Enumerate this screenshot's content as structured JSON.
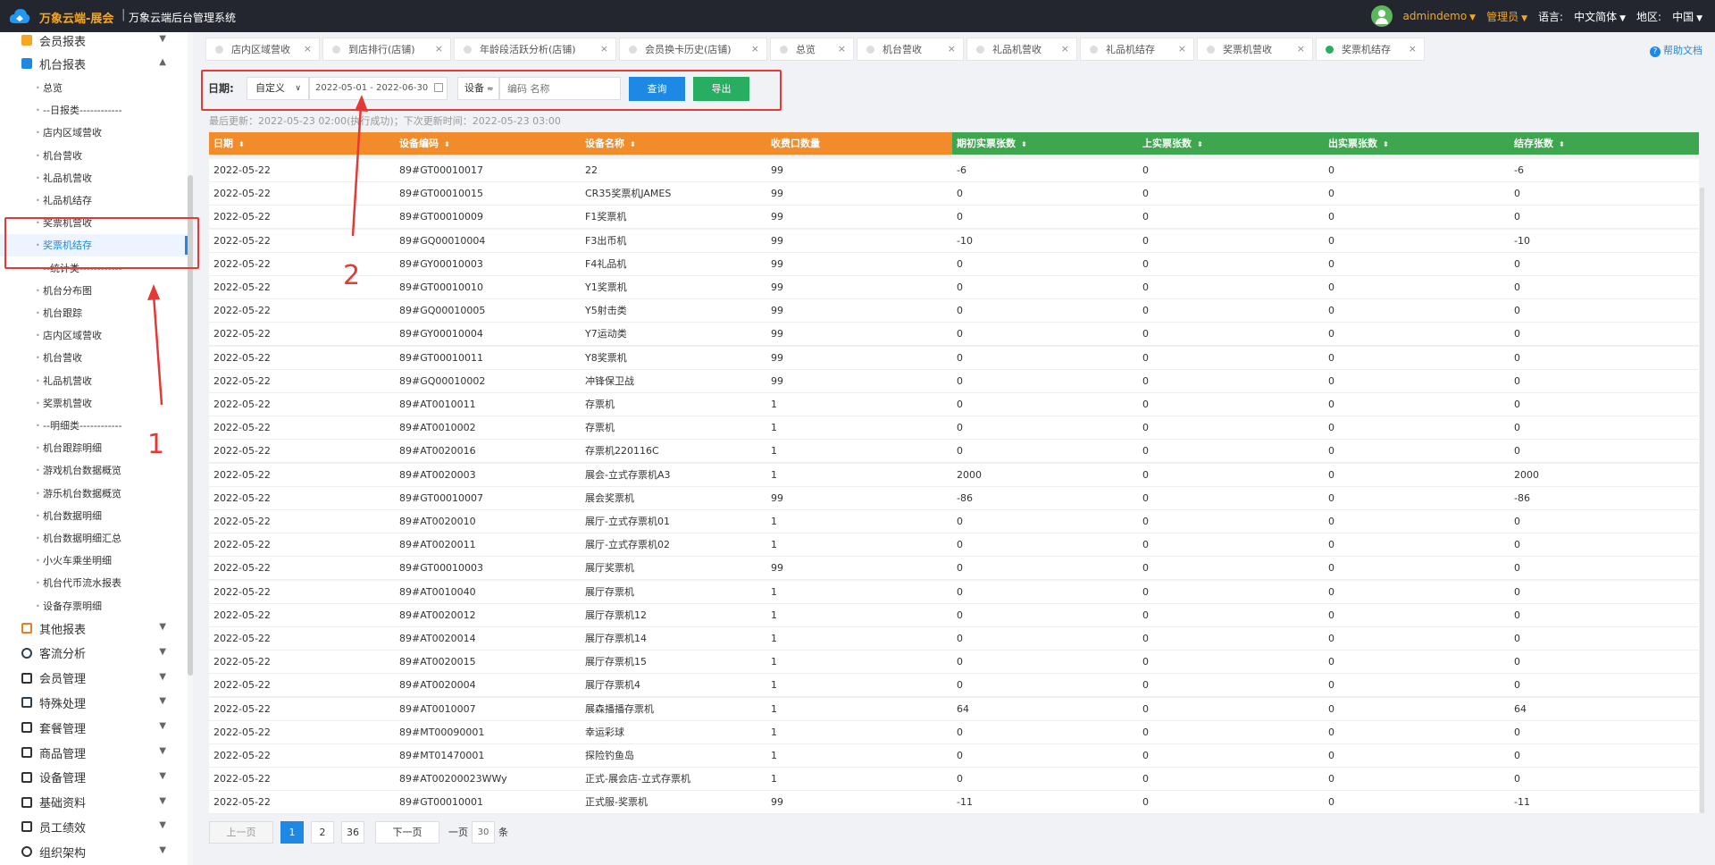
{
  "topbar": {
    "title": "万象云端-展会",
    "separator": "|",
    "subtitle": "万象云端后台管理系统",
    "user": "admindemo",
    "role": "管理员",
    "language_label": "语言:",
    "language": "中文简体",
    "region_label": "地区:",
    "region": "中国",
    "logo_color": "#2196f3"
  },
  "sidebar": {
    "groups": [
      {
        "label": "会员报表",
        "icon": "member-report-icon",
        "expanded": false
      },
      {
        "label": "机台报表",
        "icon": "machine-report-icon",
        "expanded": true
      }
    ],
    "machine_report_items": [
      "总览",
      "--日报类------------",
      "店内区域营收",
      "机台营收",
      "礼品机营收",
      "礼品机结存",
      "奖票机营收",
      "奖票机结存",
      "--统计类------------",
      "机台分布图",
      "机台跟踪",
      "店内区域营收",
      "机台营收",
      "礼品机营收",
      "奖票机营收",
      "--明细类------------",
      "机台跟踪明细",
      "游戏机台数据概览",
      "游乐机台数据概览",
      "机台数据明细",
      "机台数据明细汇总",
      "小火车乘坐明细",
      "机台代币流水报表",
      "设备存票明细"
    ],
    "active_index": 7,
    "other_groups": [
      {
        "label": "其他报表",
        "icon": "stack-icon"
      },
      {
        "label": "客流分析",
        "icon": "target-icon"
      },
      {
        "label": "会员管理",
        "icon": "user-icon"
      },
      {
        "label": "特殊处理",
        "icon": "warning-icon"
      },
      {
        "label": "套餐管理",
        "icon": "edit-icon"
      },
      {
        "label": "商品管理",
        "icon": "swap-icon"
      },
      {
        "label": "设备管理",
        "icon": "device-icon"
      },
      {
        "label": "基础资料",
        "icon": "document-icon"
      },
      {
        "label": "员工绩效",
        "icon": "gear-icon"
      },
      {
        "label": "组织架构",
        "icon": "org-icon"
      }
    ]
  },
  "tabs": [
    {
      "label": "店内区域营收",
      "active": false
    },
    {
      "label": "到店排行(店铺)",
      "active": false
    },
    {
      "label": "年龄段活跃分析(店铺)",
      "active": false
    },
    {
      "label": "会员换卡历史(店铺)",
      "active": false
    },
    {
      "label": "总览",
      "active": false
    },
    {
      "label": "机台营收",
      "active": false
    },
    {
      "label": "礼品机营收",
      "active": false
    },
    {
      "label": "礼品机结存",
      "active": false
    },
    {
      "label": "奖票机营收",
      "active": false
    },
    {
      "label": "奖票机结存",
      "active": true
    }
  ],
  "tab_close": "×",
  "help": "帮助文档",
  "filter": {
    "date_label": "日期:",
    "date_mode": "自定义",
    "date_range": "2022-05-01 - 2022-06-30",
    "device_label": "设备",
    "device_placeholder": "编码 名称",
    "query_button": "查询",
    "export_button": "导出"
  },
  "update_info": "最后更新：2022-05-23 02:00(执行成功)；下次更新时间：2022-05-23 03:00",
  "table": {
    "columns": [
      "日期",
      "设备编码",
      "设备名称",
      "收费口数量",
      "期初实票张数",
      "上实票张数",
      "出实票张数",
      "结存张数"
    ],
    "rows": [
      [
        "2022-05-22",
        "89#GT00010017",
        "22",
        "99",
        "-6",
        "0",
        "0",
        "-6"
      ],
      [
        "2022-05-22",
        "89#GT00010015",
        "CR35奖票机JAMES",
        "99",
        "0",
        "0",
        "0",
        "0"
      ],
      [
        "2022-05-22",
        "89#GT00010009",
        "F1奖票机",
        "99",
        "0",
        "0",
        "0",
        "0"
      ],
      [
        "2022-05-22",
        "89#GQ00010004",
        "F3出币机",
        "99",
        "-10",
        "0",
        "0",
        "-10"
      ],
      [
        "2022-05-22",
        "89#GY00010003",
        "F4礼品机",
        "99",
        "0",
        "0",
        "0",
        "0"
      ],
      [
        "2022-05-22",
        "89#GT00010010",
        "Y1奖票机",
        "99",
        "0",
        "0",
        "0",
        "0"
      ],
      [
        "2022-05-22",
        "89#GQ00010005",
        "Y5射击类",
        "99",
        "0",
        "0",
        "0",
        "0"
      ],
      [
        "2022-05-22",
        "89#GY00010004",
        "Y7运动类",
        "99",
        "0",
        "0",
        "0",
        "0"
      ],
      [
        "2022-05-22",
        "89#GT00010011",
        "Y8奖票机",
        "99",
        "0",
        "0",
        "0",
        "0"
      ],
      [
        "2022-05-22",
        "89#GQ00010002",
        "冲锋保卫战",
        "99",
        "0",
        "0",
        "0",
        "0"
      ],
      [
        "2022-05-22",
        "89#AT0010011",
        "存票机",
        "1",
        "0",
        "0",
        "0",
        "0"
      ],
      [
        "2022-05-22",
        "89#AT0010002",
        "存票机",
        "1",
        "0",
        "0",
        "0",
        "0"
      ],
      [
        "2022-05-22",
        "89#AT0020016",
        "存票机220116C",
        "1",
        "0",
        "0",
        "0",
        "0"
      ],
      [
        "2022-05-22",
        "89#AT0020003",
        "展会-立式存票机A3",
        "1",
        "2000",
        "0",
        "0",
        "2000"
      ],
      [
        "2022-05-22",
        "89#GT00010007",
        "展会奖票机",
        "99",
        "-86",
        "0",
        "0",
        "-86"
      ],
      [
        "2022-05-22",
        "89#AT0020010",
        "展厅-立式存票机01",
        "1",
        "0",
        "0",
        "0",
        "0"
      ],
      [
        "2022-05-22",
        "89#AT0020011",
        "展厅-立式存票机02",
        "1",
        "0",
        "0",
        "0",
        "0"
      ],
      [
        "2022-05-22",
        "89#GT00010003",
        "展厅奖票机",
        "99",
        "0",
        "0",
        "0",
        "0"
      ],
      [
        "2022-05-22",
        "89#AT0010040",
        "展厅存票机",
        "1",
        "0",
        "0",
        "0",
        "0"
      ],
      [
        "2022-05-22",
        "89#AT0020012",
        "展厅存票机12",
        "1",
        "0",
        "0",
        "0",
        "0"
      ],
      [
        "2022-05-22",
        "89#AT0020014",
        "展厅存票机14",
        "1",
        "0",
        "0",
        "0",
        "0"
      ],
      [
        "2022-05-22",
        "89#AT0020015",
        "展厅存票机15",
        "1",
        "0",
        "0",
        "0",
        "0"
      ],
      [
        "2022-05-22",
        "89#AT0020004",
        "展厅存票机4",
        "1",
        "0",
        "0",
        "0",
        "0"
      ],
      [
        "2022-05-22",
        "89#AT0010007",
        "展森播播存票机",
        "1",
        "64",
        "0",
        "0",
        "64"
      ],
      [
        "2022-05-22",
        "89#MT00090001",
        "幸运彩球",
        "1",
        "0",
        "0",
        "0",
        "0"
      ],
      [
        "2022-05-22",
        "89#MT01470001",
        "探险钓鱼岛",
        "1",
        "0",
        "0",
        "0",
        "0"
      ],
      [
        "2022-05-22",
        "89#AT00200023WWy",
        "正式-展会店-立式存票机",
        "1",
        "0",
        "0",
        "0",
        "0"
      ],
      [
        "2022-05-22",
        "89#GT00010001",
        "正式服-奖票机",
        "99",
        "-11",
        "0",
        "0",
        "-11"
      ]
    ],
    "header_colors": {
      "orange": "#f28b2a",
      "green": "#3da64e"
    }
  },
  "pager": {
    "prev": "上一页",
    "pages": [
      "1",
      "2",
      "36"
    ],
    "current": "1",
    "next": "下一页",
    "per_page_label": "一页",
    "per_page": "30",
    "per_page_unit": "条"
  },
  "annotations": {
    "labels": [
      "1",
      "2"
    ],
    "color": "#e53935"
  }
}
